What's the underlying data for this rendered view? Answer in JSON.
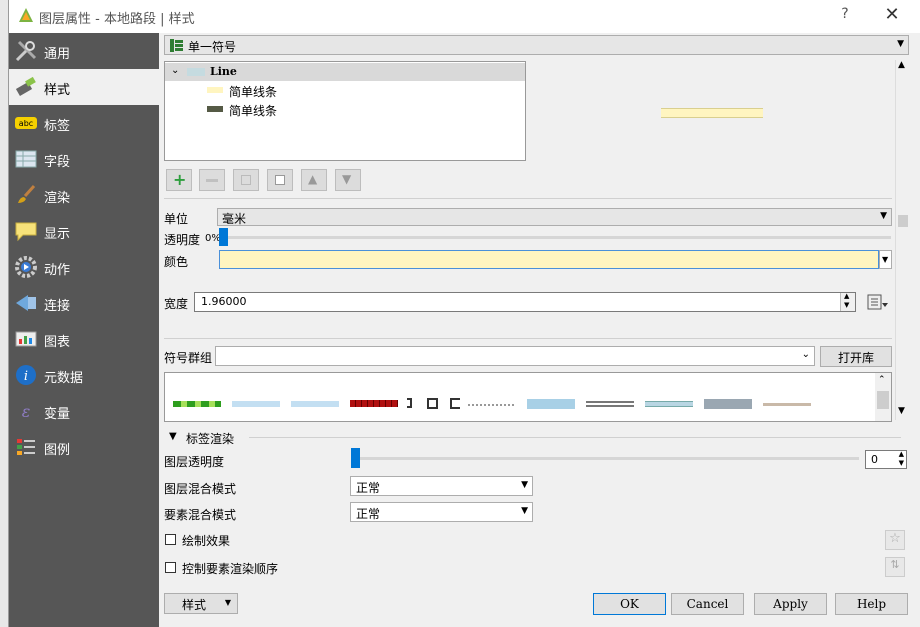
{
  "window": {
    "title": "图层属性 - 本地路段 | 样式",
    "help": "?",
    "close": "✕"
  },
  "sidebar": {
    "items": [
      {
        "label": "通用",
        "icon": "wrench-icon"
      },
      {
        "label": "样式",
        "icon": "paintbrush-icon"
      },
      {
        "label": "标签",
        "icon": "abc-label-icon"
      },
      {
        "label": "字段",
        "icon": "table-icon"
      },
      {
        "label": "渲染",
        "icon": "brush-icon"
      },
      {
        "label": "显示",
        "icon": "speech-bubble-icon"
      },
      {
        "label": "动作",
        "icon": "gear-action-icon"
      },
      {
        "label": "连接",
        "icon": "join-icon"
      },
      {
        "label": "图表",
        "icon": "chart-icon"
      },
      {
        "label": "元数据",
        "icon": "info-icon"
      },
      {
        "label": "变量",
        "icon": "variable-icon"
      },
      {
        "label": "图例",
        "icon": "legend-icon"
      }
    ]
  },
  "renderer": {
    "selected": "单一符号"
  },
  "tree": {
    "root": "Line",
    "children": [
      "简单线条",
      "简单线条"
    ]
  },
  "props": {
    "unit_label": "单位",
    "unit_value": "毫米",
    "opacity_label": "透明度",
    "opacity_value": "0%",
    "color_label": "颜色",
    "width_label": "宽度",
    "width_value": "1.96000"
  },
  "symbols": {
    "group_label": "符号群组",
    "open_library": "打开库"
  },
  "label_render": {
    "section": "标签渲染",
    "layer_opacity": "图层透明度",
    "layer_opacity_value": "0",
    "layer_blend": "图层混合模式",
    "layer_blend_value": "正常",
    "feature_blend": "要素混合模式",
    "feature_blend_value": "正常",
    "draw_effects": "绘制效果",
    "control_order": "控制要素渲染顺序"
  },
  "footer": {
    "style": "样式",
    "ok": "OK",
    "cancel": "Cancel",
    "apply": "Apply",
    "help": "Help"
  },
  "colors": {
    "sidebar": "#565656",
    "line_color": "#fff5c0",
    "accent": "#0078d7"
  }
}
